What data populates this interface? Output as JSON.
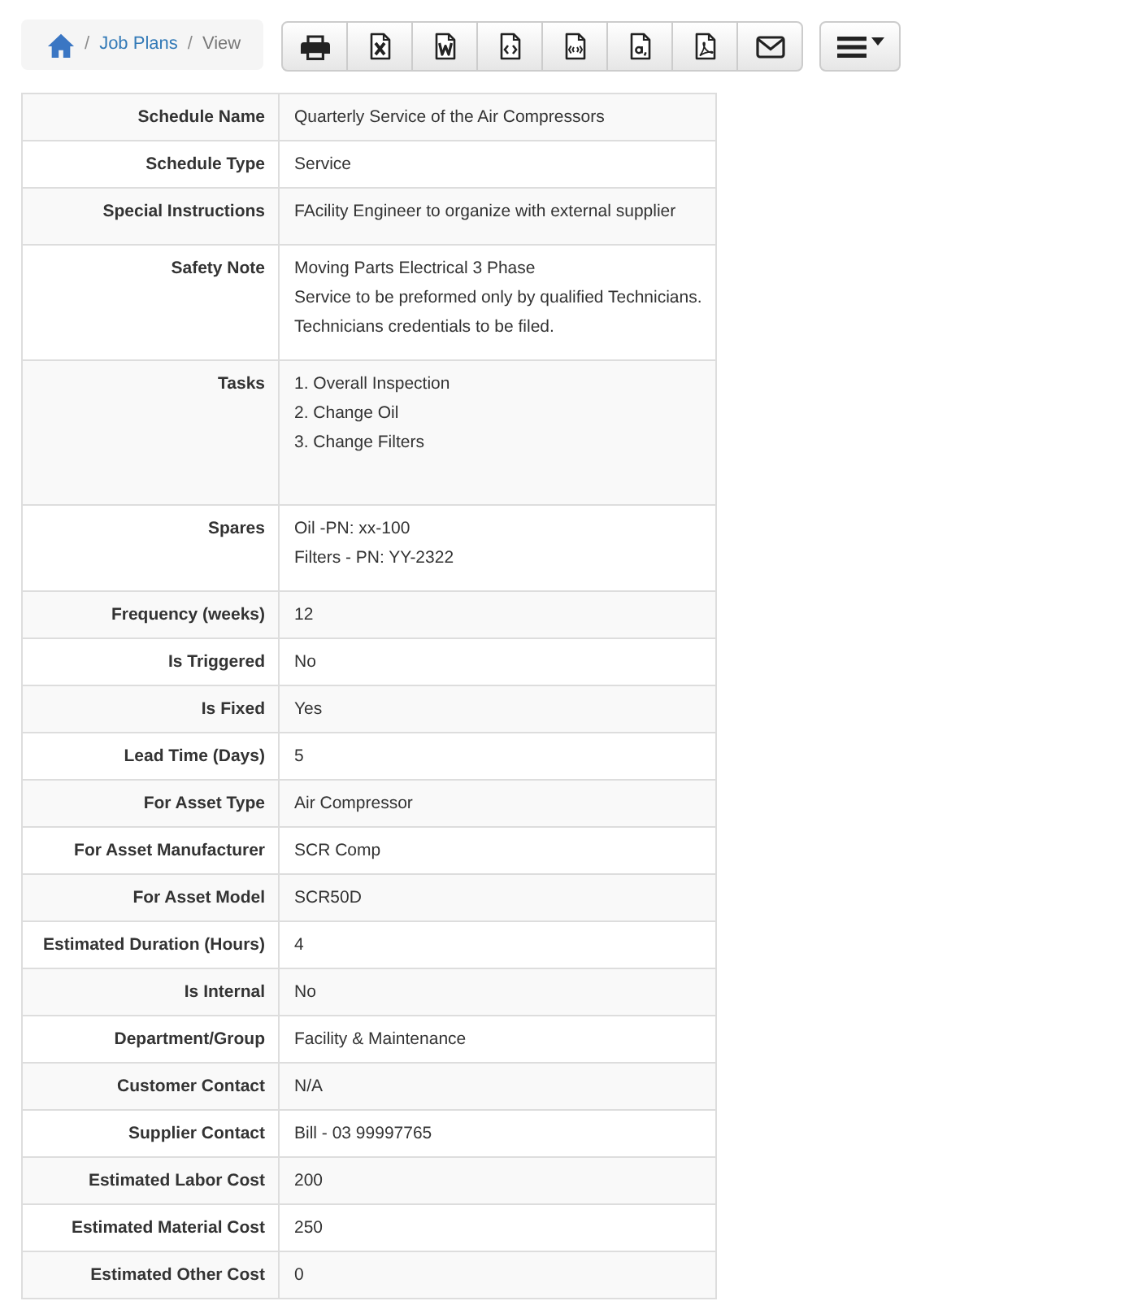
{
  "breadcrumb": {
    "items": [
      {
        "label": "Job Plans",
        "separator": "/",
        "current": false
      },
      {
        "label": "View",
        "separator": "/",
        "current": true
      }
    ]
  },
  "details": {
    "rows": [
      {
        "label": "Schedule Name",
        "kind": "text",
        "lines": [
          "Quarterly Service of the Air Compressors"
        ]
      },
      {
        "label": "Schedule Type",
        "kind": "text",
        "lines": [
          "Service"
        ]
      },
      {
        "label": "Special Instructions",
        "kind": "paragraph",
        "lines": [
          "FAcility Engineer to organize with external supplier"
        ]
      },
      {
        "label": "Safety Note",
        "kind": "paragraph",
        "lines": [
          "Moving Parts Electrical 3 Phase",
          "Service to be preformed only by qualified Technicians.",
          "Technicians credentials to be filed."
        ]
      },
      {
        "label": "Tasks",
        "kind": "list",
        "lines": [
          "1. Overall Inspection",
          "2. Change Oil",
          "3. Change Filters"
        ]
      },
      {
        "label": "Spares",
        "kind": "paragraph",
        "lines": [
          "Oil -PN: xx-100",
          "Filters - PN: YY-2322"
        ]
      },
      {
        "label": "Frequency (weeks)",
        "kind": "text",
        "lines": [
          "12"
        ]
      },
      {
        "label": "Is Triggered",
        "kind": "text",
        "lines": [
          "No"
        ]
      },
      {
        "label": "Is Fixed",
        "kind": "text",
        "lines": [
          "Yes"
        ]
      },
      {
        "label": "Lead Time (Days)",
        "kind": "text",
        "lines": [
          "5"
        ]
      },
      {
        "label": "For Asset Type",
        "kind": "text",
        "lines": [
          "Air Compressor"
        ]
      },
      {
        "label": "For Asset Manufacturer",
        "kind": "text",
        "lines": [
          "SCR Comp"
        ]
      },
      {
        "label": "For Asset Model",
        "kind": "text",
        "lines": [
          "SCR50D"
        ]
      },
      {
        "label": "Estimated Duration (Hours)",
        "kind": "text",
        "lines": [
          "4"
        ]
      },
      {
        "label": "Is Internal",
        "kind": "text",
        "lines": [
          "No"
        ]
      },
      {
        "label": "Department/Group",
        "kind": "text",
        "lines": [
          "Facility & Maintenance"
        ]
      },
      {
        "label": "Customer Contact",
        "kind": "text",
        "lines": [
          "N/A"
        ]
      },
      {
        "label": "Supplier Contact",
        "kind": "text",
        "lines": [
          "Bill - 03 99997765"
        ]
      },
      {
        "label": "Estimated Labor Cost",
        "kind": "text",
        "lines": [
          "200"
        ]
      },
      {
        "label": "Estimated Material Cost",
        "kind": "text",
        "lines": [
          "250"
        ]
      },
      {
        "label": "Estimated Other Cost",
        "kind": "text",
        "lines": [
          "0"
        ]
      }
    ]
  }
}
